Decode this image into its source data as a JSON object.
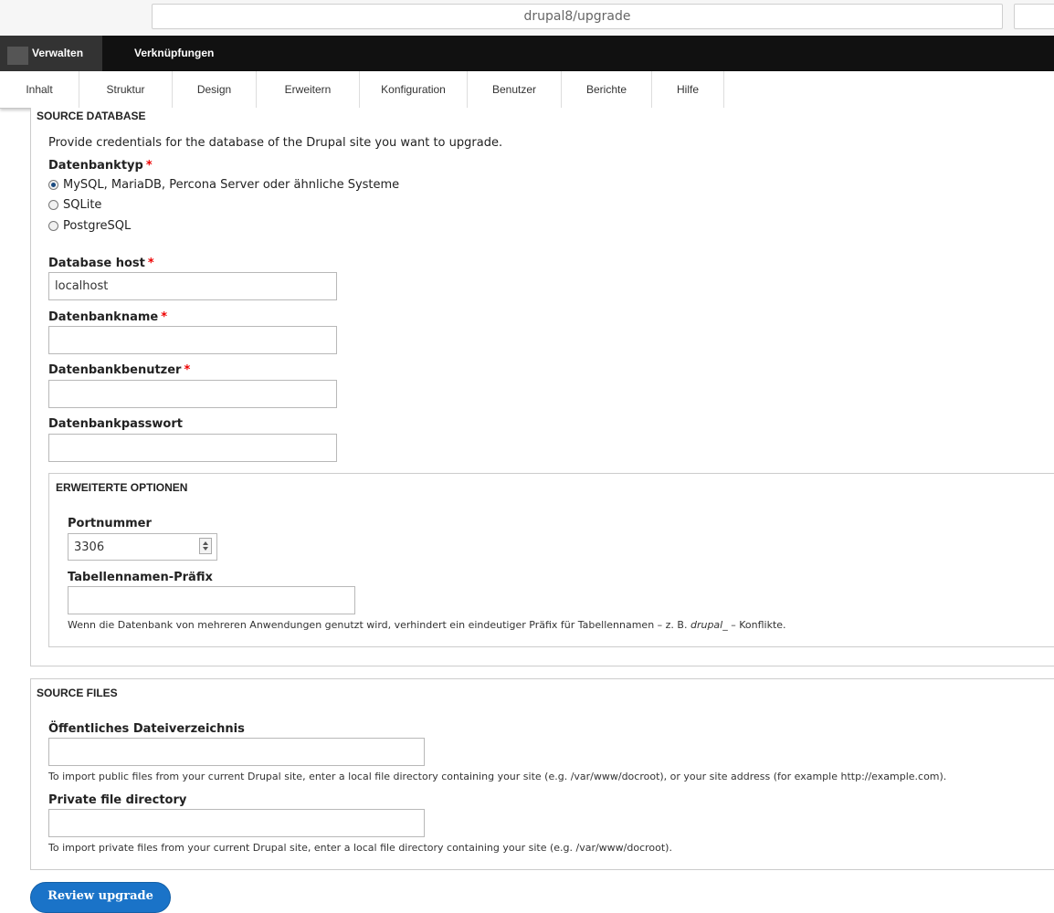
{
  "browser": {
    "url": "drupal8/upgrade"
  },
  "toolbar": {
    "manage": "Verwalten",
    "shortcuts": "Verknüpfungen"
  },
  "tray": {
    "items": [
      "Inhalt",
      "Struktur",
      "Design",
      "Erweitern",
      "Konfiguration",
      "Benutzer",
      "Berichte",
      "Hilfe"
    ]
  },
  "source_db": {
    "legend": "SOURCE DATABASE",
    "intro": "Provide credentials for the database of the Drupal site you want to upgrade.",
    "db_type_label": "Datenbanktyp",
    "db_type_options": [
      "MySQL, MariaDB, Percona Server oder ähnliche Systeme",
      "SQLite",
      "PostgreSQL"
    ],
    "db_type_selected": "MySQL, MariaDB, Percona Server oder ähnliche Systeme",
    "host_label": "Database host",
    "host_value": "localhost",
    "name_label": "Datenbankname",
    "name_value": "",
    "user_label": "Datenbankbenutzer",
    "user_value": "",
    "pass_label": "Datenbankpasswort",
    "pass_value": "",
    "required_marker": "*",
    "advanced": {
      "legend": "ERWEITERTE OPTIONEN",
      "port_label": "Portnummer",
      "port_value": "3306",
      "prefix_label": "Tabellennamen-Präfix",
      "prefix_value": "",
      "prefix_desc_before": "Wenn die Datenbank von mehreren Anwendungen genutzt wird, verhindert ein eindeutiger Präfix für Tabellennamen – z. B. ",
      "prefix_desc_em": "drupal_",
      "prefix_desc_after": " – Konflikte."
    }
  },
  "source_files": {
    "legend": "SOURCE FILES",
    "public_label": "Öffentliches Dateiverzeichnis",
    "public_value": "",
    "public_desc": "To import public files from your current Drupal site, enter a local file directory containing your site (e.g. /var/www/docroot), or your site address (for example http://example.com).",
    "private_label": "Private file directory",
    "private_value": "",
    "private_desc": "To import private files from your current Drupal site, enter a local file directory containing your site (e.g. /var/www/docroot)."
  },
  "submit": {
    "label": "Review upgrade"
  }
}
